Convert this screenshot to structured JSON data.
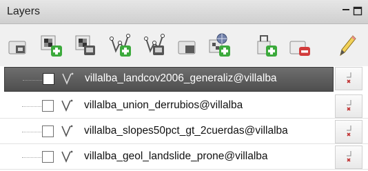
{
  "panel": {
    "title": "Layers",
    "title_icons": [
      "minimize-icon",
      "float-window-icon"
    ]
  },
  "toolbar": {
    "buttons": [
      {
        "name": "open-layer-styling-icon"
      },
      {
        "name": "add-raster-layer-icon"
      },
      {
        "name": "add-raster-group-icon"
      },
      {
        "name": "add-vector-layer-icon"
      },
      {
        "name": "add-vector-group-icon"
      },
      {
        "name": "add-group-icon"
      },
      {
        "name": "add-wms-layer-icon"
      },
      {
        "name": "add-existing-icon"
      },
      {
        "name": "remove-layer-icon"
      },
      {
        "name": "edit-pencil-icon"
      }
    ]
  },
  "layers": [
    {
      "name": "villalba_landcov2006_generaliz@villalba",
      "selected": true,
      "checked": false
    },
    {
      "name": "villalba_union_derrubios@villalba",
      "selected": false,
      "checked": false
    },
    {
      "name": "villalba_slopes50pct_gt_2cuerdas@villalba",
      "selected": false,
      "checked": false
    },
    {
      "name": "villalba_geol_landslide_prone@villalba",
      "selected": false,
      "checked": false
    }
  ],
  "colors": {
    "selected_row": "#585858",
    "add_green": "#3caa3c",
    "remove_red": "#d23c3c"
  }
}
